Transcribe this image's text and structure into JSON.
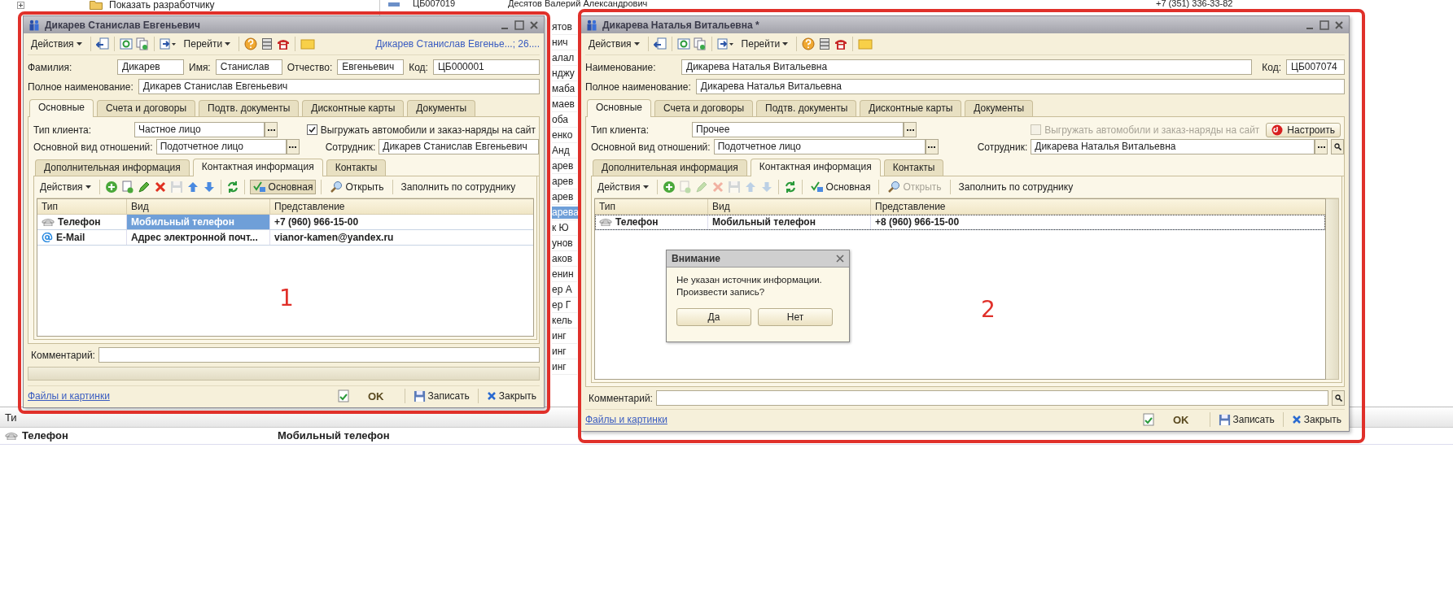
{
  "background": {
    "tree_item": "Показать разработчику",
    "list_top_row": [
      "ЦБ007019",
      "Десятов Валерий Александрович",
      "+7 (351) 336-33-82"
    ],
    "list_fragments": [
      {
        "text": "ятов",
        "selected": false
      },
      {
        "text": "нич",
        "selected": false
      },
      {
        "text": "алал",
        "selected": false
      },
      {
        "text": "нджу",
        "selected": false
      },
      {
        "text": "маба",
        "selected": false
      },
      {
        "text": "маев",
        "selected": false
      },
      {
        "text": "оба",
        "selected": false
      },
      {
        "text": "енко",
        "selected": false
      },
      {
        "text": "Анд",
        "selected": false
      },
      {
        "text": "арев",
        "selected": false
      },
      {
        "text": "арев",
        "selected": false
      },
      {
        "text": "арев",
        "selected": false
      },
      {
        "text": "арева",
        "selected": true
      },
      {
        "text": "к Ю",
        "selected": false
      },
      {
        "text": "унов",
        "selected": false
      },
      {
        "text": "аков",
        "selected": false
      },
      {
        "text": "енин",
        "selected": false
      },
      {
        "text": "ер А",
        "selected": false
      },
      {
        "text": "ер Г",
        "selected": false
      },
      {
        "text": "кель",
        "selected": false
      },
      {
        "text": "инг",
        "selected": false
      },
      {
        "text": "инг",
        "selected": false
      },
      {
        "text": "инг",
        "selected": false
      }
    ],
    "bottom_header": "Ти",
    "bottom_row": [
      "Телефон",
      "Мобильный телефон"
    ]
  },
  "windows": [
    {
      "title": "Дикарев Станислав Евгеньевич",
      "actions": "Действия",
      "goto": "Перейти",
      "link": "Дикарев Станислав Евгенье...; 26....",
      "header_rows": [
        [
          {
            "label": "Фамилия:",
            "value": "Дикарев"
          },
          {
            "label": "Имя:",
            "value": "Станислав"
          },
          {
            "label": "Отчество:",
            "value": "Евгеньевич"
          },
          {
            "label": "Код:",
            "value": "ЦБ000001"
          }
        ],
        [
          {
            "label": "Полное наименование:",
            "value": "Дикарев Станислав Евгеньевич"
          }
        ]
      ],
      "tabs": [
        {
          "label": "Основные",
          "selected": true
        },
        {
          "label": "Счета и договоры",
          "selected": false
        },
        {
          "label": "Подтв. документы",
          "selected": false
        },
        {
          "label": "Дисконтные карты",
          "selected": false
        },
        {
          "label": "Документы",
          "selected": false
        }
      ],
      "client_type": {
        "label": "Тип клиента:",
        "value": "Частное лицо"
      },
      "export_checkbox": {
        "label": "Выгружать автомобили и заказ-наряды на сайт",
        "checked": true,
        "disabled": false
      },
      "relation": {
        "label": "Основной вид отношений:",
        "value": "Подотчетное лицо"
      },
      "employee": {
        "label": "Сотрудник:",
        "value": "Дикарев Станислав Евгеньевич",
        "buttons": false
      },
      "subtabs": [
        {
          "label": "Дополнительная информация",
          "selected": false
        },
        {
          "label": "Контактная информация",
          "selected": true
        },
        {
          "label": "Контакты",
          "selected": false
        }
      ],
      "contact_toolbar": {
        "actions": "Действия",
        "tools": [
          {
            "kind": "add",
            "disabled": false
          },
          {
            "kind": "copy",
            "disabled": false
          },
          {
            "kind": "edit",
            "disabled": false
          },
          {
            "kind": "delete",
            "disabled": false
          },
          {
            "kind": "save",
            "disabled": true
          },
          {
            "kind": "up",
            "disabled": false
          },
          {
            "kind": "down",
            "disabled": false
          },
          {
            "kind": "refresh",
            "disabled": false
          }
        ],
        "main_button": {
          "label": "Основная",
          "pressed": true
        },
        "open_button": {
          "label": "Открыть",
          "disabled": false
        },
        "fill_button": "Заполнить по сотруднику"
      },
      "table": {
        "columns": [
          "Тип",
          "Вид",
          "Представление"
        ],
        "rows": [
          {
            "kind": "phone",
            "cells": [
              {
                "text": "Телефон",
                "selected": false
              },
              {
                "text": "Мобильный телефон",
                "selected": true
              },
              {
                "text": "+7 (960) 966-15-00",
                "selected": false
              }
            ]
          },
          {
            "kind": "email",
            "cells": [
              {
                "text": "E-Mail",
                "selected": false
              },
              {
                "text": "Адрес электронной почт...",
                "selected": false
              },
              {
                "text": "vianor-kamen@yandex.ru",
                "selected": false
              }
            ]
          }
        ]
      },
      "comment": "Комментарий:",
      "footer": {
        "files": "Файлы и картинки",
        "ok": "OK",
        "save": "Записать",
        "close": "Закрыть"
      }
    },
    {
      "title": "Дикарева Наталья Витальевна *",
      "actions": "Действия",
      "goto": "Перейти",
      "header_rows": [
        [
          {
            "label": "Наименование:",
            "value": "Дикарева Наталья Витальевна"
          },
          {
            "label": "Код:",
            "value": "ЦБ007074"
          }
        ],
        [
          {
            "label": "Полное наименование:",
            "value": "Дикарева Наталья Витальевна"
          }
        ]
      ],
      "tabs": [
        {
          "label": "Основные",
          "selected": true
        },
        {
          "label": "Счета и договоры",
          "selected": false
        },
        {
          "label": "Подтв. документы",
          "selected": false
        },
        {
          "label": "Дисконтные карты",
          "selected": false
        },
        {
          "label": "Документы",
          "selected": false
        }
      ],
      "client_type": {
        "label": "Тип клиента:",
        "value": "Прочее"
      },
      "export_checkbox": {
        "label": "Выгружать автомобили и заказ-наряды на сайт",
        "checked": false,
        "disabled": true
      },
      "setup_button": "Настроить",
      "relation": {
        "label": "Основной вид отношений:",
        "value": "Подотчетное лицо"
      },
      "employee": {
        "label": "Сотрудник:",
        "value": "Дикарева Наталья Витальевна",
        "buttons": true
      },
      "subtabs": [
        {
          "label": "Дополнительная информация",
          "selected": false
        },
        {
          "label": "Контактная информация",
          "selected": true
        },
        {
          "label": "Контакты",
          "selected": false
        }
      ],
      "contact_toolbar": {
        "actions": "Действия",
        "tools": [
          {
            "kind": "add",
            "disabled": false
          },
          {
            "kind": "copy",
            "disabled": true
          },
          {
            "kind": "edit",
            "disabled": true
          },
          {
            "kind": "delete",
            "disabled": true
          },
          {
            "kind": "save",
            "disabled": true
          },
          {
            "kind": "up",
            "disabled": true
          },
          {
            "kind": "down",
            "disabled": true
          },
          {
            "kind": "refresh",
            "disabled": false
          }
        ],
        "main_button": {
          "label": "Основная",
          "pressed": false
        },
        "open_button": {
          "label": "Открыть",
          "disabled": true
        },
        "fill_button": "Заполнить по сотруднику"
      },
      "table": {
        "columns": [
          "Тип",
          "Вид",
          "Представление"
        ],
        "rows": [
          {
            "kind": "phone",
            "cells": [
              {
                "text": "Телефон",
                "selected": false
              },
              {
                "text": "Мобильный телефон",
                "selected": false
              },
              {
                "text": "+8 (960) 966-15-00",
                "selected": false
              }
            ]
          }
        ]
      },
      "comment": "Комментарий:",
      "footer": {
        "files": "Файлы и картинки",
        "ok": "OK",
        "save": "Записать",
        "close": "Закрыть"
      }
    }
  ],
  "dialog": {
    "title": "Внимание",
    "message": "Не указан источник информации.\nПроизвести запись?",
    "buttons": [
      "Да",
      "Нет"
    ]
  },
  "annotations": [
    "1",
    "2"
  ]
}
